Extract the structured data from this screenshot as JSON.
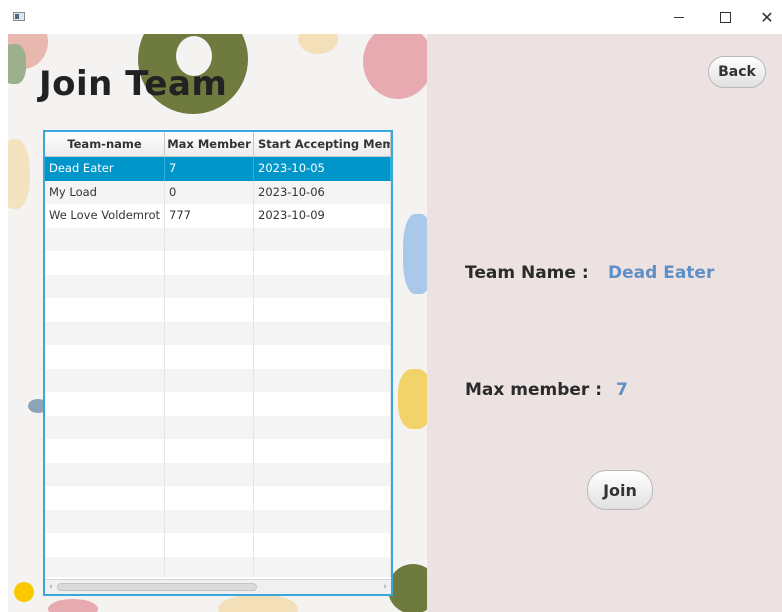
{
  "window": {
    "controls": {
      "minimize": "—",
      "maximize": "☐",
      "close": "✕"
    }
  },
  "page": {
    "title": "Join Team"
  },
  "table": {
    "columns": [
      "Team-name",
      "Max Member",
      "Start Accepting Member"
    ],
    "rows": [
      {
        "name": "Dead Eater",
        "max": "7",
        "start": "2023-10-05",
        "selected": true
      },
      {
        "name": "My Load",
        "max": "0",
        "start": "2023-10-06",
        "selected": false
      },
      {
        "name": "We Love Voldemrot",
        "max": "777",
        "start": "2023-10-09",
        "selected": false
      }
    ],
    "scroll": {
      "left_arrow": "‹",
      "right_arrow": "›"
    }
  },
  "details": {
    "team_name_label": "Team Name :",
    "team_name_value": "Dead Eater",
    "max_member_label": "Max member :",
    "max_member_value": "7"
  },
  "buttons": {
    "back": "Back",
    "join": "Join"
  },
  "colors": {
    "accent": "#0096c9",
    "table_border": "#39a6dc",
    "value_text": "#5f8fc4",
    "right_panel": "#ede2e2"
  }
}
